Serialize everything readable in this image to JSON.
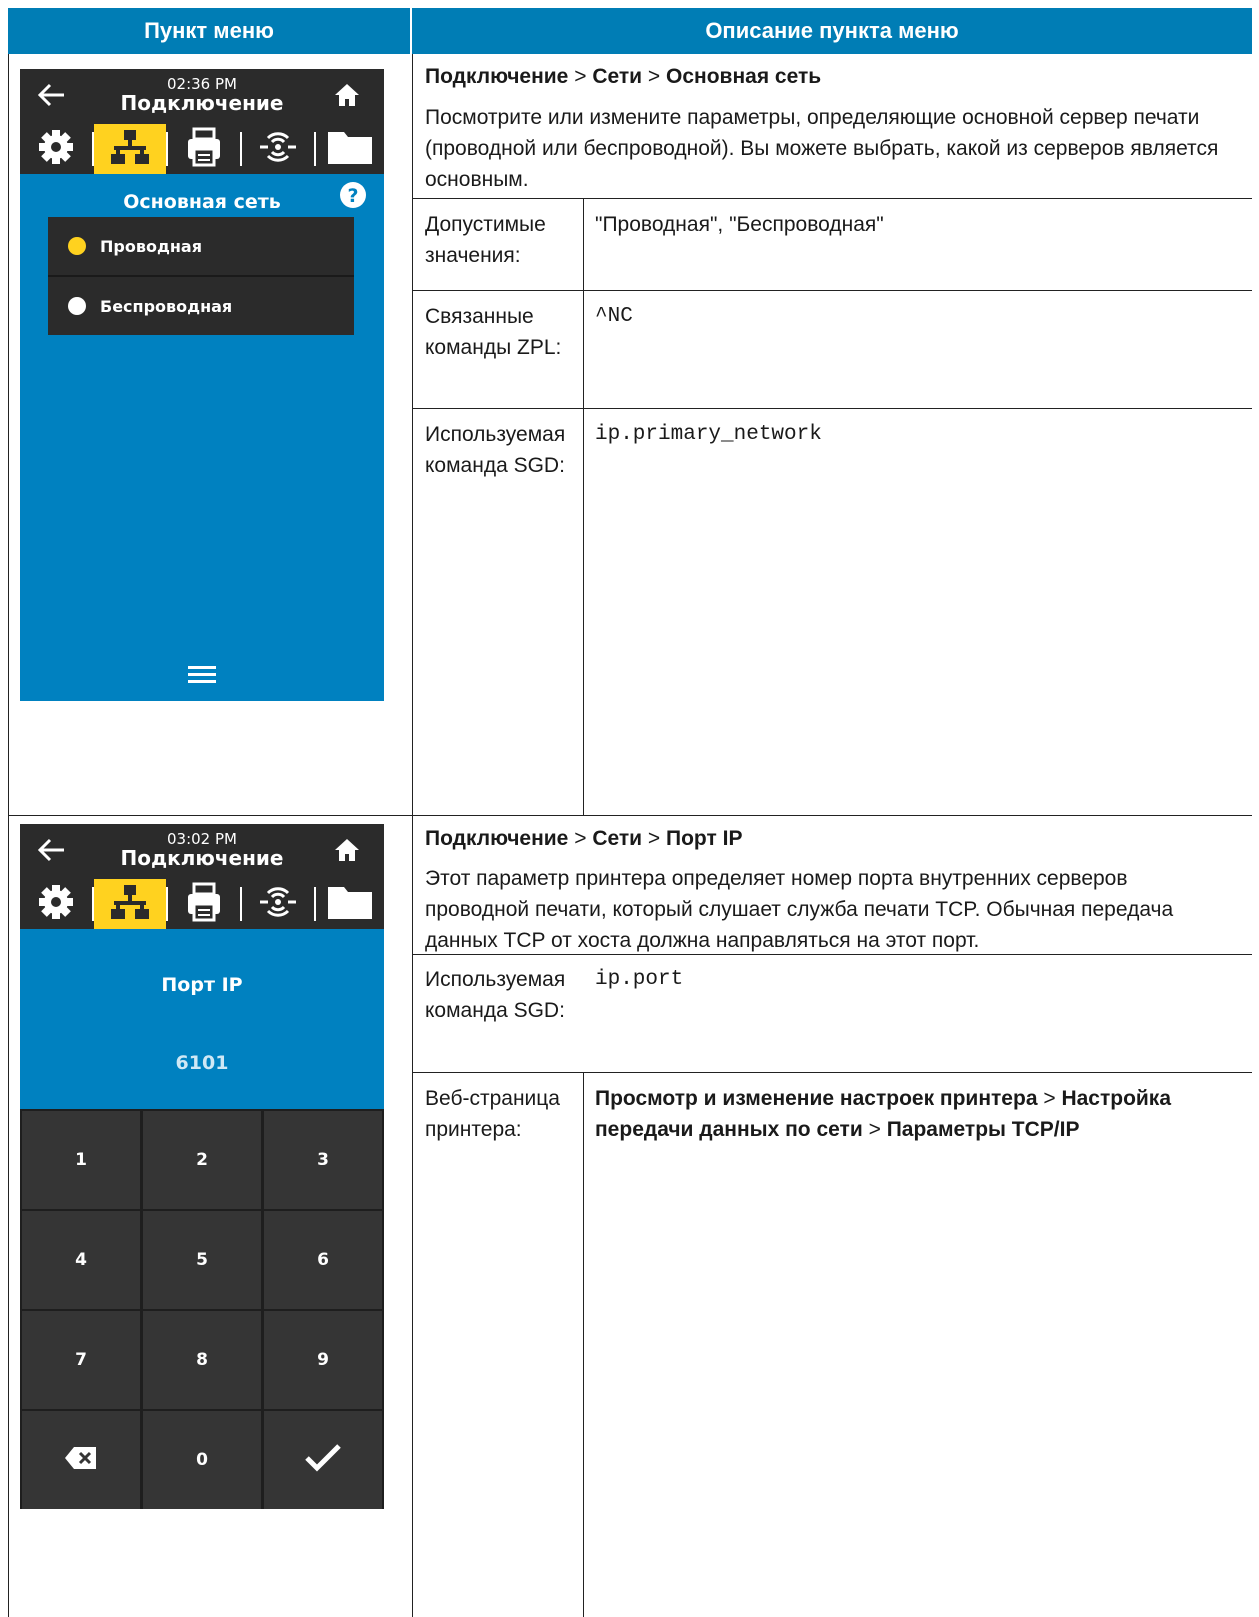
{
  "header": {
    "col_item": "Пункт меню",
    "col_desc": "Описание пункта меню"
  },
  "row1": {
    "screen": {
      "time": "02:36 PM",
      "title": "Подключение",
      "subtitle": "Основная сеть",
      "options": [
        {
          "label": "Проводная",
          "selected": true
        },
        {
          "label": "Беспроводная",
          "selected": false
        }
      ],
      "icons": [
        "back-arrow-icon",
        "home-icon",
        "gear-icon",
        "network-icon",
        "printer-icon",
        "wireless-icon",
        "folder-icon",
        "help-icon",
        "menu-icon"
      ]
    },
    "path": {
      "p1": "Подключение",
      "sep1": " > ",
      "p2": "Сети",
      "sep2": " > ",
      "p3": "Основная сеть"
    },
    "description": "Посмотрите или измените параметры, определяющие основной сервер печати (проводной или беспроводной). Вы можете выбрать, какой из серверов является основным.",
    "props": [
      {
        "label": "Допустимые значения:",
        "value": "\"Проводная\", \"Беспроводная\""
      },
      {
        "label": "Связанные команды ZPL:",
        "value": "^NC"
      },
      {
        "label": "Используемая команда SGD:",
        "value": "ip.primary_network"
      }
    ]
  },
  "row2": {
    "screen": {
      "time": "03:02 PM",
      "title": "Подключение",
      "subtitle": "Порт IP",
      "value": "6101",
      "keys": [
        "1",
        "2",
        "3",
        "4",
        "5",
        "6",
        "7",
        "8",
        "9",
        "⌫",
        "0",
        "✓"
      ]
    },
    "path": {
      "p1": "Подключение",
      "sep1": " > ",
      "p2": "Сети",
      "sep2": " > ",
      "p3": "Порт IP"
    },
    "description": "Этот параметр принтера определяет номер порта внутренних серверов проводной печати, который слушает служба печати TCP. Обычная передача данных TCP от хоста должна направляться на этот порт.",
    "props": [
      {
        "label": "Используемая команда SGD:",
        "value": "ip.port"
      },
      {
        "label": "Веб-страница принтера:",
        "v1": "Просмотр и изменение настроек принтера",
        "s1": " > ",
        "v2": "Настройка передачи данных по сети",
        "s2": " > ",
        "v3": "Параметры TCP/IP"
      }
    ]
  }
}
